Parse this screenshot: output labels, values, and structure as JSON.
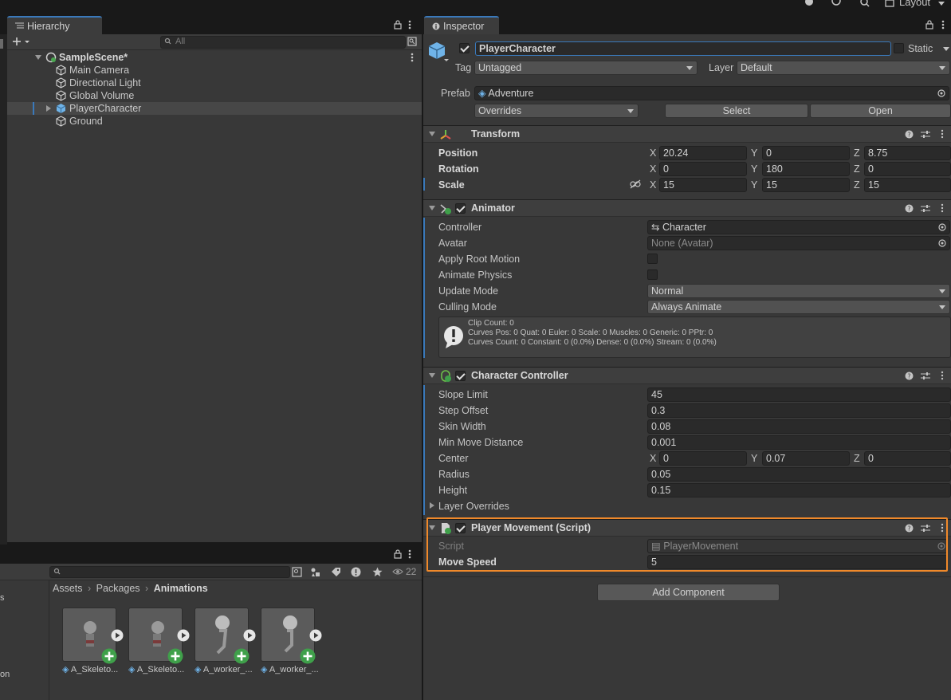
{
  "topbar": {
    "layout_label": "Layout"
  },
  "hierarchy": {
    "tab_label": "Hierarchy",
    "search_placeholder": "All",
    "scene_name": "SampleScene*",
    "items": [
      {
        "label": "Main Camera"
      },
      {
        "label": "Directional Light"
      },
      {
        "label": "Global Volume"
      },
      {
        "label": "PlayerCharacter"
      },
      {
        "label": "Ground"
      }
    ]
  },
  "project": {
    "breadcrumb": [
      "Assets",
      "Packages",
      "Animations"
    ],
    "visible_count": "22",
    "assets": [
      {
        "name": "A_Skeleto..."
      },
      {
        "name": "A_Skeleto..."
      },
      {
        "name": "A_worker_..."
      },
      {
        "name": "A_worker_..."
      }
    ],
    "side_fragments": [
      "s",
      "on"
    ]
  },
  "inspector": {
    "tab_label": "Inspector",
    "object_name": "PlayerCharacter",
    "static_label": "Static",
    "tag_label": "Tag",
    "tag_value": "Untagged",
    "layer_label": "Layer",
    "layer_value": "Default",
    "prefab_label": "Prefab",
    "prefab_value": "Adventure",
    "overrides_label": "Overrides",
    "select_label": "Select",
    "open_label": "Open",
    "transform": {
      "title": "Transform",
      "position_label": "Position",
      "rotation_label": "Rotation",
      "scale_label": "Scale",
      "position": {
        "x": "20.24",
        "y": "0",
        "z": "8.75"
      },
      "rotation": {
        "x": "0",
        "y": "180",
        "z": "0"
      },
      "scale": {
        "x": "15",
        "y": "15",
        "z": "15"
      }
    },
    "animator": {
      "title": "Animator",
      "controller_label": "Controller",
      "controller_value": "Character",
      "avatar_label": "Avatar",
      "avatar_value": "None (Avatar)",
      "apply_root_motion_label": "Apply Root Motion",
      "animate_physics_label": "Animate Physics",
      "update_mode_label": "Update Mode",
      "update_mode_value": "Normal",
      "culling_mode_label": "Culling Mode",
      "culling_mode_value": "Always Animate",
      "info_line1": "Clip Count: 0",
      "info_line2": "Curves Pos: 0 Quat: 0 Euler: 0 Scale: 0 Muscles: 0 Generic: 0 PPtr: 0",
      "info_line3": "Curves Count: 0 Constant: 0 (0.0%) Dense: 0 (0.0%) Stream: 0 (0.0%)"
    },
    "character_controller": {
      "title": "Character Controller",
      "slope_limit_label": "Slope Limit",
      "slope_limit": "45",
      "step_offset_label": "Step Offset",
      "step_offset": "0.3",
      "skin_width_label": "Skin Width",
      "skin_width": "0.08",
      "min_move_label": "Min Move Distance",
      "min_move": "0.001",
      "center_label": "Center",
      "center": {
        "x": "0",
        "y": "0.07",
        "z": "0"
      },
      "radius_label": "Radius",
      "radius": "0.05",
      "height_label": "Height",
      "height": "0.15",
      "layer_overrides_label": "Layer Overrides"
    },
    "player_movement": {
      "title": "Player Movement (Script)",
      "script_label": "Script",
      "script_value": "PlayerMovement",
      "move_speed_label": "Move Speed",
      "move_speed": "5"
    },
    "add_component_label": "Add Component",
    "axis": {
      "x": "X",
      "y": "Y",
      "z": "Z"
    },
    "highlight_color": "#f0892a"
  }
}
